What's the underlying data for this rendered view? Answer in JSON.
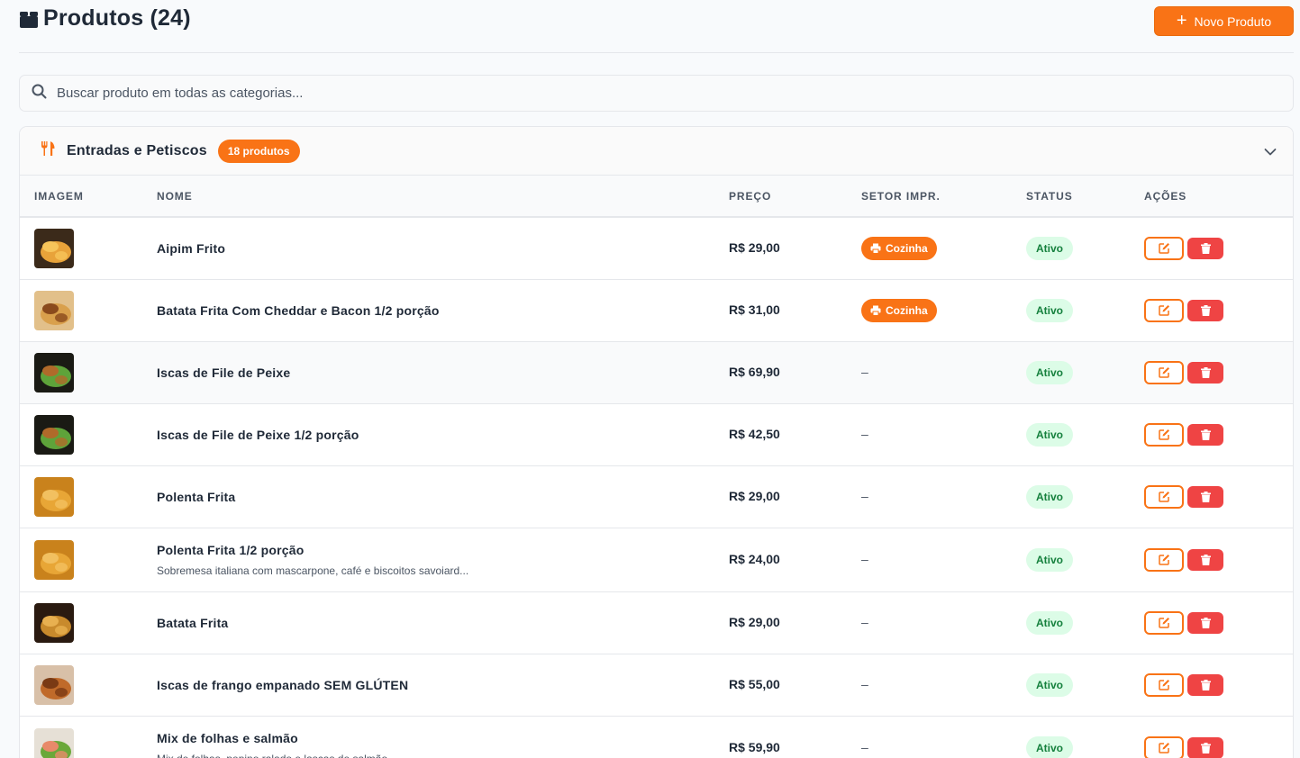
{
  "header": {
    "title": "Produtos (24)",
    "new_button_label": "Novo Produto",
    "plus_glyph": "+",
    "title_icon": "box-icon"
  },
  "search": {
    "placeholder": "Buscar produto em todas as categorias...",
    "value": ""
  },
  "category": {
    "icon": "utensils-icon",
    "title": "Entradas e Petiscos",
    "badge": "18 produtos",
    "expanded": true
  },
  "table": {
    "columns": [
      "IMAGEM",
      "NOME",
      "PREÇO",
      "SETOR IMPR.",
      "STATUS",
      "AÇÕES"
    ],
    "rows": [
      {
        "name": "Aipim Frito",
        "description": "",
        "price": "R$ 29,00",
        "sector": "Cozinha",
        "status": "Ativo"
      },
      {
        "name": "Batata Frita Com Cheddar e Bacon 1/2 porção",
        "description": "",
        "price": "R$ 31,00",
        "sector": "Cozinha",
        "status": "Ativo"
      },
      {
        "name": "Iscas de File de Peixe",
        "description": "",
        "price": "R$ 69,90",
        "sector": "–",
        "status": "Ativo"
      },
      {
        "name": "Iscas de File de Peixe 1/2 porção",
        "description": "",
        "price": "R$ 42,50",
        "sector": "–",
        "status": "Ativo"
      },
      {
        "name": "Polenta Frita",
        "description": "",
        "price": "R$ 29,00",
        "sector": "–",
        "status": "Ativo"
      },
      {
        "name": "Polenta Frita 1/2 porção",
        "description": "Sobremesa italiana com mascarpone, café e biscoitos savoiard...",
        "price": "R$ 24,00",
        "sector": "–",
        "status": "Ativo"
      },
      {
        "name": "Batata Frita",
        "description": "",
        "price": "R$ 29,00",
        "sector": "–",
        "status": "Ativo"
      },
      {
        "name": "Iscas de frango empanado SEM GLÚTEN",
        "description": "",
        "price": "R$ 55,00",
        "sector": "–",
        "status": "Ativo"
      },
      {
        "name": "Mix de folhas e salmão",
        "description": "Mix de folhas, pepino ralado e lascas de salmão",
        "price": "R$ 59,90",
        "sector": "–",
        "status": "Ativo"
      }
    ]
  },
  "colors": {
    "accent": "#f97316",
    "danger": "#ef4444",
    "active_bg": "#dcfce7",
    "active_text": "#15803d"
  }
}
